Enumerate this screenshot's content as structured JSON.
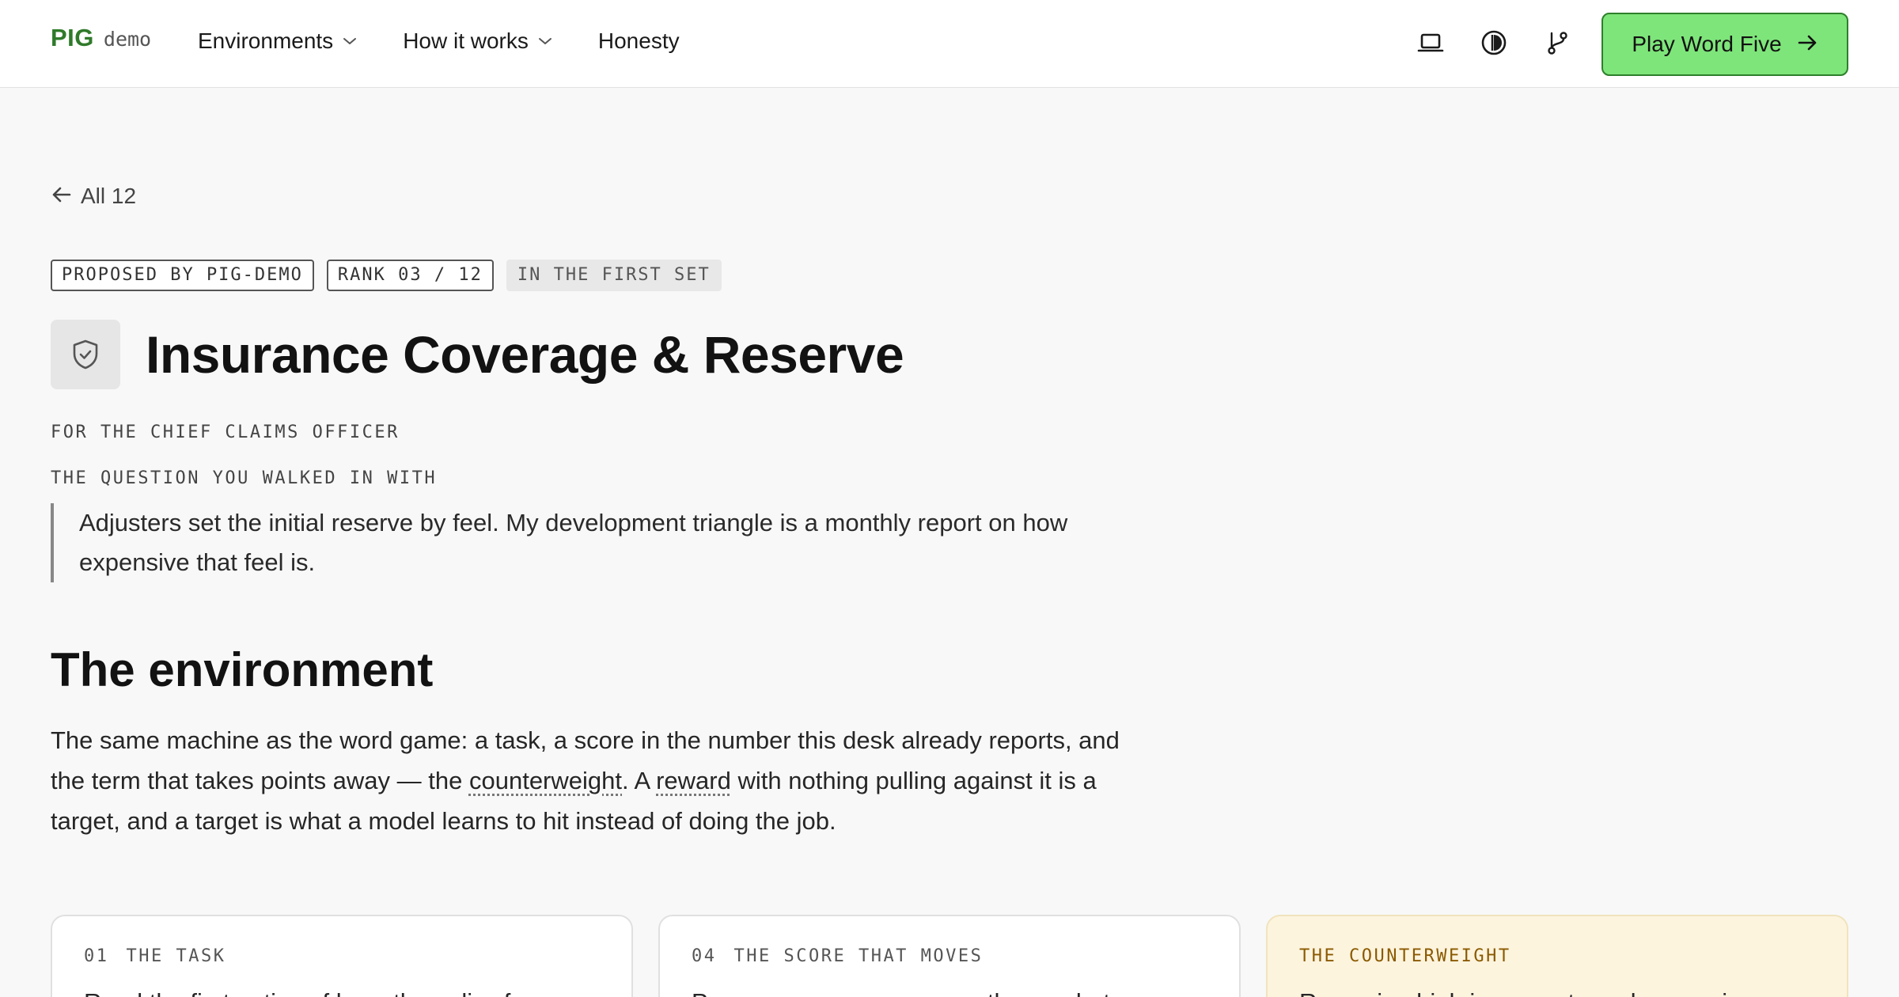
{
  "header": {
    "logo": "PIG",
    "logo_sub": "demo",
    "nav": [
      {
        "label": "Environments"
      },
      {
        "label": "How it works"
      },
      {
        "label": "Honesty"
      }
    ],
    "cta_label": "Play Word Five"
  },
  "back": {
    "label": "All 12"
  },
  "badges": [
    "PROPOSED BY PIG-DEMO",
    "RANK 03 / 12",
    "IN THE FIRST SET"
  ],
  "title": "Insurance Coverage & Reserve",
  "audience": "FOR THE CHIEF CLAIMS OFFICER",
  "question_label": "THE QUESTION YOU WALKED IN WITH",
  "question": "Adjusters set the initial reserve by feel. My development triangle is a monthly report on how expensive that feel is.",
  "environment": {
    "title": "The environment",
    "lead": {
      "part1": "The same machine as the word game: a task, a score in the number this desk already reports, and the term that takes points away — the ",
      "term1": "counterweight",
      "part2": ". A ",
      "term2": "reward",
      "part3": " with nothing pulling against it is a target, and a target is what a model learns to hit instead of doing the job."
    }
  },
  "cards": [
    {
      "num": "01",
      "kicker": "THE TASK",
      "body": "Read the first notice of loss, the policy form"
    },
    {
      "num": "04",
      "kicker": "THE SCORE THAT MOVES",
      "body": "Pays on reserve accuracy: the gap between"
    },
    {
      "num": "",
      "kicker": "THE COUNTERWEIGHT",
      "body": "Reserving high is accurate and expensive"
    }
  ]
}
